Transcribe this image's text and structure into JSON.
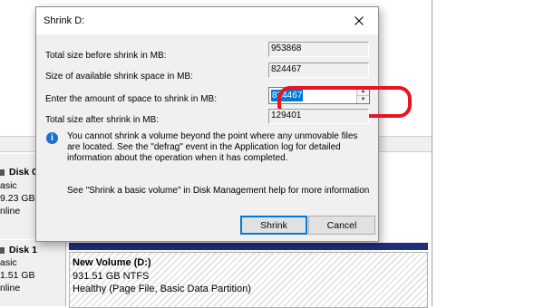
{
  "dialog": {
    "title": "Shrink D:",
    "close_glyph": "✕",
    "rows": [
      {
        "label": "Total size before shrink in MB:",
        "value": "953868"
      },
      {
        "label": "Size of available shrink space in MB:",
        "value": "824467"
      },
      {
        "label": "Enter the amount of space to shrink in MB:",
        "value": "824467"
      },
      {
        "label": "Total size after shrink in MB:",
        "value": "129401"
      }
    ],
    "info_icon": "info-icon",
    "info_text": "You cannot shrink a volume beyond the point where any unmovable files are located. See the \"defrag\" event in the Application log for detailed information about the operation when it has completed.",
    "help_text": "See \"Shrink a basic volume\" in Disk Management help for more information",
    "buttons": {
      "shrink": "Shrink",
      "cancel": "Cancel"
    },
    "highlight_color": "#e8141f"
  },
  "background": {
    "disks": [
      {
        "name": "Disk 0",
        "type": "asic",
        "size": "9.23 GB",
        "status": "nline"
      },
      {
        "name": "Disk 1",
        "type": "asic",
        "size": "1.51 GB",
        "status": "nline"
      }
    ],
    "volume": {
      "name": "New Volume  (D:)",
      "size": "931.51 GB NTFS",
      "status": "Healthy (Page File, Basic Data Partition)"
    }
  }
}
